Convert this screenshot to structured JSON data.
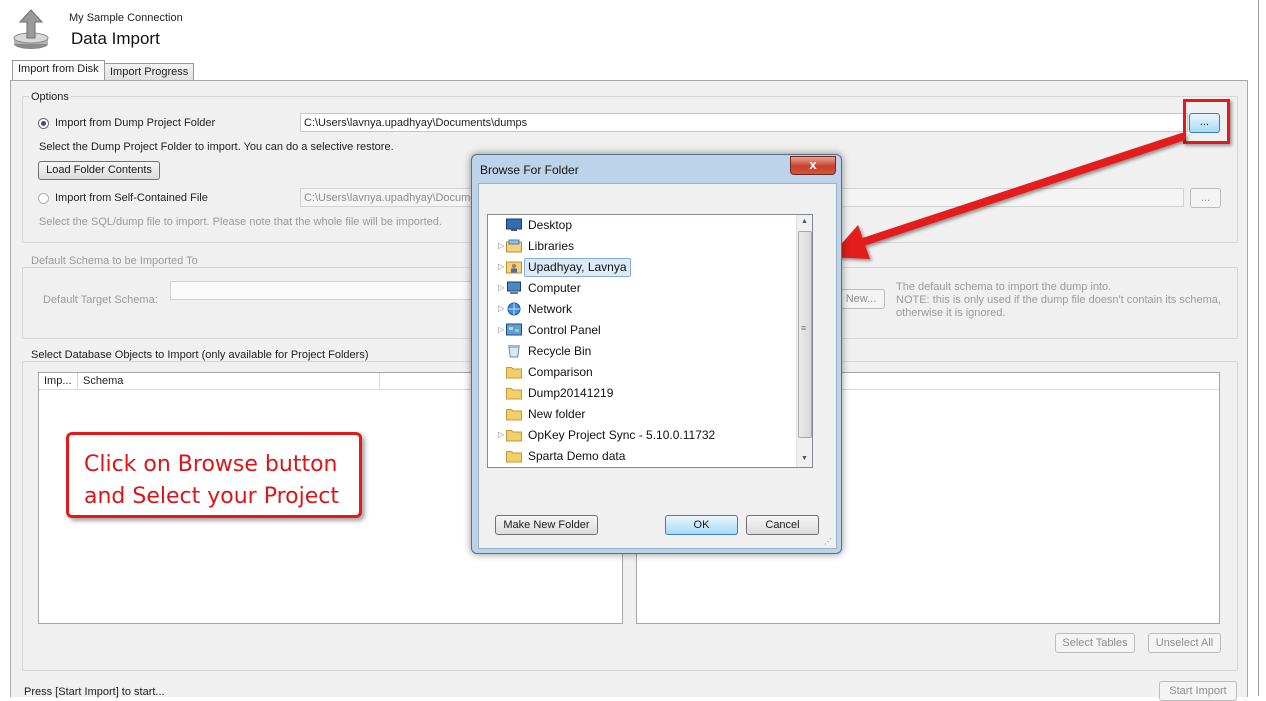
{
  "header": {
    "connection_name": "My Sample Connection",
    "title": "Data Import"
  },
  "tabs": [
    {
      "label": "Import from Disk",
      "active": true
    },
    {
      "label": "Import Progress",
      "active": false
    }
  ],
  "options": {
    "group_title": "Options",
    "dump_folder_label": "Import from Dump Project Folder",
    "dump_folder_path": "C:\\Users\\lavnya.upadhyay\\Documents\\dumps",
    "dump_folder_selected": true,
    "dump_folder_hint": "Select the Dump Project Folder to import. You can do a selective restore.",
    "load_folder_button": "Load Folder Contents",
    "browse_button": "...",
    "self_contained_label": "Import from Self-Contained File",
    "self_contained_path": "C:\\Users\\lavnya.upadhyay\\Docume",
    "self_contained_browse": "...",
    "self_contained_hint": "Select the SQL/dump file to import. Please note that the whole file will be imported."
  },
  "default_schema": {
    "group_title": "Default Schema to be Imported To",
    "label": "Default Target Schema:",
    "new_button": "New...",
    "note_line1": "The default schema to import the dump into.",
    "note_line2": "NOTE: this is only used if the dump file doesn't contain its schema,",
    "note_line3": "otherwise it is ignored."
  },
  "objects": {
    "group_title": "Select Database Objects to Import (only available for Project Folders)",
    "columns": [
      "Imp...",
      "Schema"
    ],
    "select_tables_button": "Select Tables",
    "unselect_all_button": "Unselect All"
  },
  "footer": {
    "status": "Press [Start Import] to start...",
    "start_button": "Start Import"
  },
  "dialog": {
    "title": "Browse For Folder",
    "close_label": "x",
    "tree_items": [
      {
        "label": "Desktop",
        "icon": "desktop-icon",
        "expandable": false,
        "selected": false
      },
      {
        "label": "Libraries",
        "icon": "libraries-icon",
        "expandable": true,
        "selected": false
      },
      {
        "label": "Upadhyay, Lavnya",
        "icon": "user-folder-icon",
        "expandable": true,
        "selected": true
      },
      {
        "label": "Computer",
        "icon": "computer-icon",
        "expandable": true,
        "selected": false
      },
      {
        "label": "Network",
        "icon": "network-icon",
        "expandable": true,
        "selected": false
      },
      {
        "label": "Control Panel",
        "icon": "control-panel-icon",
        "expandable": true,
        "selected": false
      },
      {
        "label": "Recycle Bin",
        "icon": "recycle-bin-icon",
        "expandable": false,
        "selected": false
      },
      {
        "label": "Comparison",
        "icon": "folder-icon",
        "expandable": false,
        "selected": false
      },
      {
        "label": "Dump20141219",
        "icon": "folder-icon",
        "expandable": false,
        "selected": false
      },
      {
        "label": "New folder",
        "icon": "folder-icon",
        "expandable": false,
        "selected": false
      },
      {
        "label": "OpKey Project Sync - 5.10.0.11732",
        "icon": "folder-icon",
        "expandable": true,
        "selected": false
      },
      {
        "label": "Sparta Demo data",
        "icon": "folder-icon",
        "expandable": false,
        "selected": false
      }
    ],
    "make_new_folder_button": "Make New Folder",
    "ok_button": "OK",
    "cancel_button": "Cancel"
  },
  "annotation": {
    "line1": "Click on Browse button",
    "line2": "and Select your Project",
    "color": "#e41a1a"
  }
}
